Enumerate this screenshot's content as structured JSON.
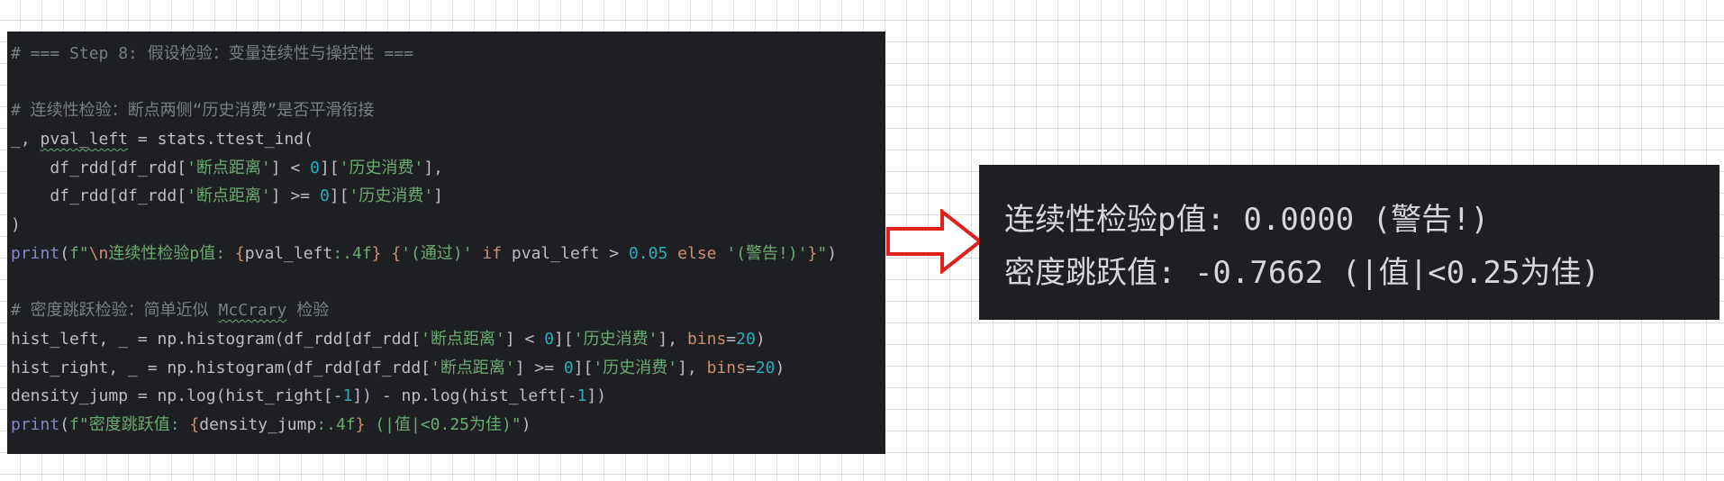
{
  "code_editor": {
    "lines": [
      [
        {
          "t": "# === Step 8: 假设检验：变量连续性与操控性 ===",
          "c": "comment"
        }
      ],
      [],
      [
        {
          "t": "# 连续性检验：断点两侧“历史消费”是否平滑衔接",
          "c": "comment"
        }
      ],
      [
        {
          "t": "_, ",
          "c": ""
        },
        {
          "t": "pval_left",
          "c": "squiggle"
        },
        {
          "t": " = stats.ttest_ind(",
          "c": ""
        }
      ],
      [
        {
          "t": "    df_rdd[df_rdd[",
          "c": ""
        },
        {
          "t": "'断点距离'",
          "c": "string"
        },
        {
          "t": "] < ",
          "c": ""
        },
        {
          "t": "0",
          "c": "number"
        },
        {
          "t": "][",
          "c": ""
        },
        {
          "t": "'历史消费'",
          "c": "string"
        },
        {
          "t": "],",
          "c": ""
        }
      ],
      [
        {
          "t": "    df_rdd[df_rdd[",
          "c": ""
        },
        {
          "t": "'断点距离'",
          "c": "string"
        },
        {
          "t": "] >= ",
          "c": ""
        },
        {
          "t": "0",
          "c": "number"
        },
        {
          "t": "][",
          "c": ""
        },
        {
          "t": "'历史消费'",
          "c": "string"
        },
        {
          "t": "]",
          "c": ""
        }
      ],
      [
        {
          "t": ")",
          "c": ""
        }
      ],
      [
        {
          "t": "print",
          "c": "builtin"
        },
        {
          "t": "(",
          "c": ""
        },
        {
          "t": "f\"",
          "c": "string"
        },
        {
          "t": "\\n",
          "c": "escape"
        },
        {
          "t": "连续性检验p值: ",
          "c": "string"
        },
        {
          "t": "{",
          "c": "brace"
        },
        {
          "t": "pval_left",
          "c": ""
        },
        {
          "t": ":.4f",
          "c": "fmt"
        },
        {
          "t": "}",
          "c": "brace"
        },
        {
          "t": " ",
          "c": "string"
        },
        {
          "t": "{",
          "c": "brace"
        },
        {
          "t": "'(通过)'",
          "c": "string"
        },
        {
          "t": " if ",
          "c": "keyword"
        },
        {
          "t": "pval_left > ",
          "c": ""
        },
        {
          "t": "0.05",
          "c": "number"
        },
        {
          "t": " else ",
          "c": "keyword"
        },
        {
          "t": "'(警告!)'",
          "c": "string"
        },
        {
          "t": "}",
          "c": "brace"
        },
        {
          "t": "\"",
          "c": "string"
        },
        {
          "t": ")",
          "c": ""
        }
      ],
      [],
      [
        {
          "t": "# 密度跳跃检验：简单近似 ",
          "c": "comment"
        },
        {
          "t": "McCrary",
          "c": "comment-squiggle"
        },
        {
          "t": " 检验",
          "c": "comment"
        }
      ],
      [
        {
          "t": "hist_left, _ = np.histogram(df_rdd[df_rdd[",
          "c": ""
        },
        {
          "t": "'断点距离'",
          "c": "string"
        },
        {
          "t": "] < ",
          "c": ""
        },
        {
          "t": "0",
          "c": "number"
        },
        {
          "t": "][",
          "c": ""
        },
        {
          "t": "'历史消费'",
          "c": "string"
        },
        {
          "t": "], ",
          "c": ""
        },
        {
          "t": "bins",
          "c": "param"
        },
        {
          "t": "=",
          "c": ""
        },
        {
          "t": "20",
          "c": "number"
        },
        {
          "t": ")",
          "c": ""
        }
      ],
      [
        {
          "t": "hist_right, _ = np.histogram(df_rdd[df_rdd[",
          "c": ""
        },
        {
          "t": "'断点距离'",
          "c": "string"
        },
        {
          "t": "] >= ",
          "c": ""
        },
        {
          "t": "0",
          "c": "number"
        },
        {
          "t": "][",
          "c": ""
        },
        {
          "t": "'历史消费'",
          "c": "string"
        },
        {
          "t": "], ",
          "c": ""
        },
        {
          "t": "bins",
          "c": "param"
        },
        {
          "t": "=",
          "c": ""
        },
        {
          "t": "20",
          "c": "number"
        },
        {
          "t": ")",
          "c": ""
        }
      ],
      [
        {
          "t": "density_jump = np.log(hist_right[-",
          "c": ""
        },
        {
          "t": "1",
          "c": "number"
        },
        {
          "t": "]) - np.log(hist_left[-",
          "c": ""
        },
        {
          "t": "1",
          "c": "number"
        },
        {
          "t": "])",
          "c": ""
        }
      ],
      [
        {
          "t": "print",
          "c": "builtin"
        },
        {
          "t": "(",
          "c": ""
        },
        {
          "t": "f\"密度跳跃值: ",
          "c": "string"
        },
        {
          "t": "{",
          "c": "brace"
        },
        {
          "t": "density_jump",
          "c": ""
        },
        {
          "t": ":.4f",
          "c": "fmt"
        },
        {
          "t": "}",
          "c": "brace"
        },
        {
          "t": " (|值|<0.25为佳)\"",
          "c": "string"
        },
        {
          "t": ")",
          "c": ""
        }
      ]
    ]
  },
  "arrow": {
    "icon": "right-arrow-icon",
    "color": "#e0201b"
  },
  "output": {
    "line1": "连续性检验p值: 0.0000 (警告!)",
    "line2": "密度跳跃值: -0.7662 (|值|<0.25为佳)"
  },
  "colors": {
    "panel_bg": "#1e1f22",
    "grid_line": "#dcdcdc"
  }
}
